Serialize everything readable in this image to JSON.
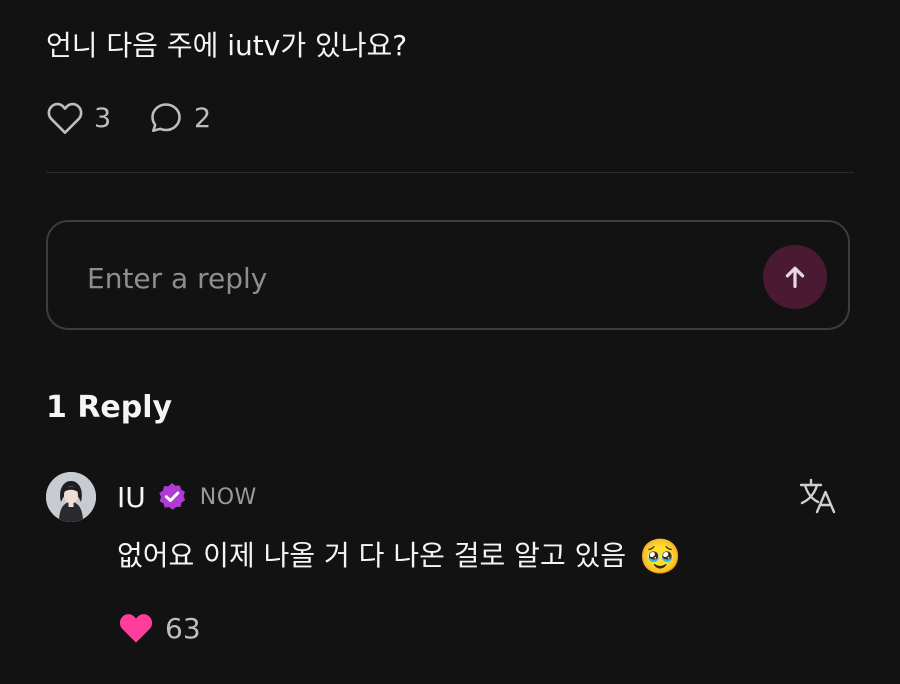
{
  "post": {
    "text": "언니 다음 주에 iutv가 있나요?",
    "like_count": "3",
    "comment_count": "2",
    "like_icon": "heart-outline-icon",
    "comment_icon": "chat-bubble-icon"
  },
  "reply_box": {
    "placeholder": "Enter a reply",
    "send_icon": "arrow-up-icon",
    "send_button_color": "#4a1a33"
  },
  "replies": {
    "heading": "1 Reply",
    "items": [
      {
        "author": "IU",
        "verified_icon": "verified-badge-icon",
        "verified_color": "#b03ad6",
        "timestamp": "NOW",
        "text": "없어요 이제 나올 거 다 나온 걸로 알고 있음",
        "emoji": "🥹",
        "like_count": "63",
        "like_color": "#ff3d9a",
        "translate_icon": "translate-icon"
      }
    ]
  }
}
